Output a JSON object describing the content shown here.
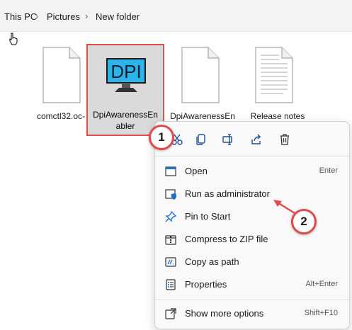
{
  "breadcrumb": [
    "This PC",
    "Pictures",
    "New folder"
  ],
  "files": [
    {
      "label_line1": "comctl32.oc-",
      "label_line2": "",
      "icon": "blank-file-icon"
    },
    {
      "label_line1": "DpiAwarenessEn",
      "label_line2": "abler",
      "icon": "dpi-monitor-icon",
      "icon_text": "DPI",
      "selected": true
    },
    {
      "label_line1": "DpiAwarenessEn",
      "label_line2": "",
      "icon": "blank-file-icon"
    },
    {
      "label_line1": "Release notes",
      "label_line2": "",
      "icon": "text-document-icon"
    }
  ],
  "context_menu": {
    "toolbar": [
      "cut-icon",
      "copy-icon",
      "rename-icon",
      "share-icon",
      "delete-icon"
    ],
    "items": [
      {
        "label": "Open",
        "shortcut": "Enter",
        "icon": "open-window-icon"
      },
      {
        "label": "Run as administrator",
        "shortcut": "",
        "icon": "shield-window-icon"
      },
      {
        "label": "Pin to Start",
        "shortcut": "",
        "icon": "pin-icon"
      },
      {
        "label": "Compress to ZIP file",
        "shortcut": "",
        "icon": "zip-icon"
      },
      {
        "label": "Copy as path",
        "shortcut": "",
        "icon": "path-icon"
      },
      {
        "label": "Properties",
        "shortcut": "Alt+Enter",
        "icon": "properties-icon"
      },
      {
        "label": "Show more options",
        "shortcut": "Shift+F10",
        "icon": "more-options-icon"
      }
    ]
  },
  "annotations": [
    "1",
    "2"
  ],
  "colors": {
    "highlight": "#e14b4b",
    "accent": "#1f6fcf"
  }
}
